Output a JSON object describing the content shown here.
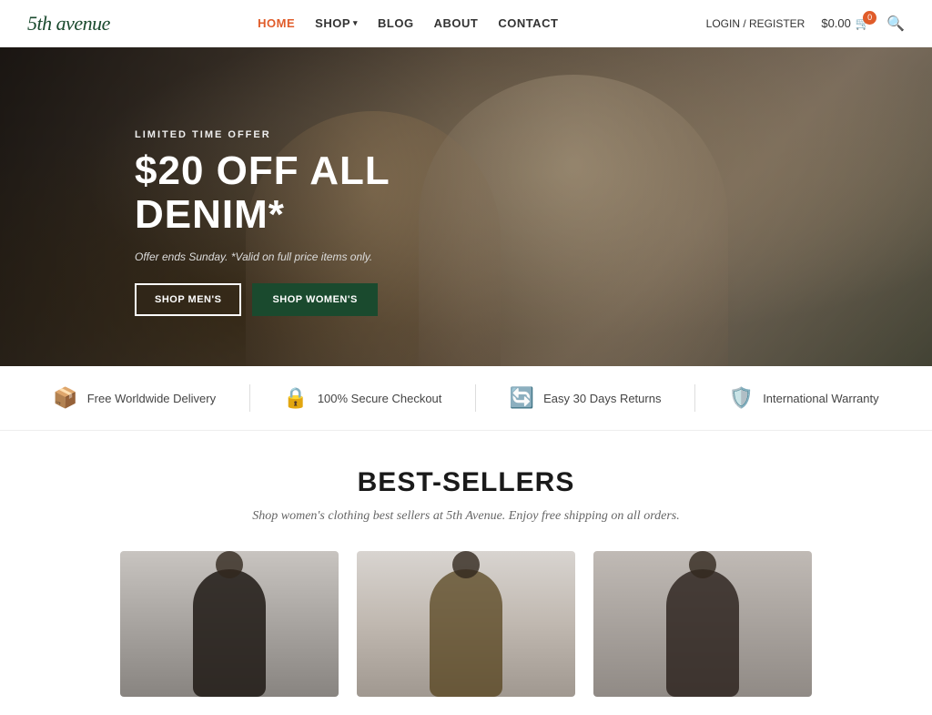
{
  "header": {
    "logo": "5th avenue",
    "nav": {
      "home": "HOME",
      "shop": "SHOP",
      "blog": "BLOG",
      "about": "ABOUT",
      "contact": "CONTACT"
    },
    "login": "LOGIN / REGISTER",
    "cart_price": "$0.00",
    "cart_count": "0"
  },
  "hero": {
    "limited_offer": "LIMITED TIME OFFER",
    "heading_line1": "$20 OFF ALL",
    "heading_line2": "DENIM*",
    "subtext": "Offer ends Sunday. *Valid on full price items only.",
    "btn_mens": "SHOP MEN'S",
    "btn_womens": "SHOP WOMEN'S"
  },
  "features": [
    {
      "icon": "📦",
      "text": "Free Worldwide Delivery"
    },
    {
      "icon": "🔒",
      "text": "100% Secure Checkout"
    },
    {
      "icon": "🔄",
      "text": "Easy 30 Days Returns"
    },
    {
      "icon": "🛡️",
      "text": "International Warranty"
    }
  ],
  "bestsellers": {
    "title": "BEST-SELLERS",
    "subtitle": "Shop women's clothing best sellers at 5th Avenue. Enjoy free shipping on all orders."
  }
}
